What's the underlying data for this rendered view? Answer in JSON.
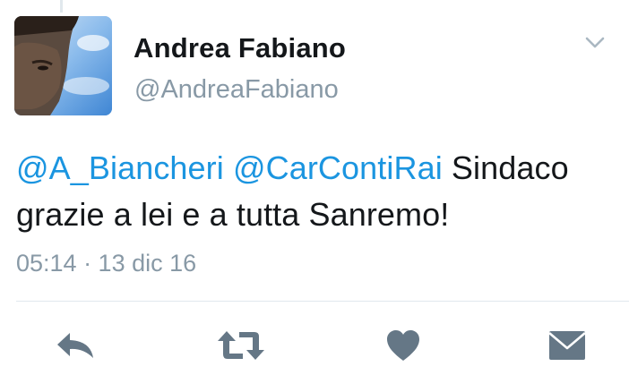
{
  "tweet": {
    "author": {
      "display_name": "Andrea Fabiano",
      "handle": "@AndreaFabiano"
    },
    "text": {
      "mention_1": "@A_Biancheri",
      "mention_2": "@CarContiRai",
      "body": "Sindaco grazie a lei e a tutta Sanremo!"
    },
    "timestamp": "05:14 · 13 dic 16"
  },
  "icons": {
    "avatar": "avatar-photo",
    "menu": "chevron-down-icon",
    "reply": "reply-icon",
    "retweet": "retweet-icon",
    "like": "heart-icon",
    "direct_message": "envelope-icon"
  },
  "colors": {
    "text": "#14171a",
    "secondary_text": "#8899a6",
    "link": "#1b95e0",
    "action_icon": "#657786",
    "divider": "#e1e8ed"
  }
}
